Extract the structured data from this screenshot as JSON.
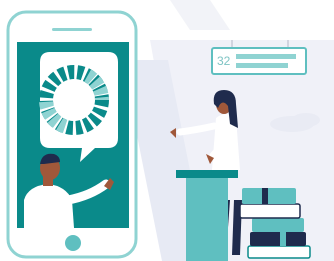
{
  "colors": {
    "teal_dark": "#0a8a8a",
    "teal_mid": "#5fbfc0",
    "teal_light": "#8fd3d2",
    "navy": "#1f2b4d",
    "skin": "#a0583a",
    "background_shape": "#eef0f7"
  },
  "sign": {
    "number": "32"
  },
  "phone": {
    "speech_bubble_icon": "loading-spinner-icon",
    "caller": "man-waving"
  },
  "presenter": {
    "description_icon": "woman-at-podium"
  },
  "books": {
    "count": 6
  }
}
